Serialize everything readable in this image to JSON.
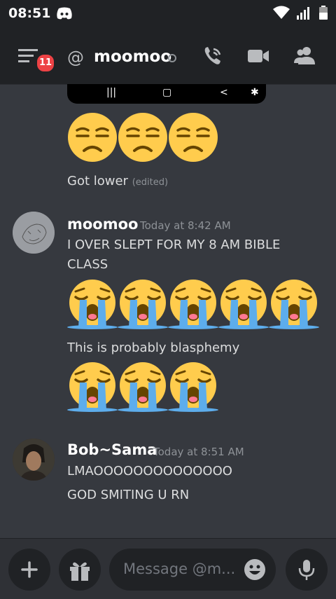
{
  "status_bar": {
    "time": "08:51"
  },
  "header": {
    "unread_count": "11",
    "at_symbol": "@",
    "channel_name": "moomoo"
  },
  "messages": {
    "continuation": {
      "text": "Got lower",
      "edited": "(edited)"
    },
    "group1": {
      "author": "moomoo",
      "timestamp": "Today at 8:42 AM",
      "line1": "I OVER SLEPT FOR MY 8 AM BIBLE",
      "line2": "CLASS",
      "line3": "This is probably blasphemy"
    },
    "group2": {
      "author": "Bob~Sama",
      "timestamp": "Today at 8:51 AM",
      "line1": "LMAOOOOOOOOOOOOOO",
      "line2": "GOD SMITING U RN"
    }
  },
  "composer": {
    "placeholder": "Message @m..."
  },
  "colors": {
    "bg": "#36393f",
    "header_bg": "#202225",
    "badge": "#ed4245",
    "emoji_yellow": "#ffcc4d",
    "tear_blue": "#5dadec"
  },
  "icons": [
    "discord-icon",
    "wifi-icon",
    "signal-icon",
    "battery-icon",
    "menu-icon",
    "phone-call-icon",
    "video-icon",
    "members-icon",
    "plus-icon",
    "gift-icon",
    "emoji-picker-icon",
    "microphone-icon",
    "unamused-face-icon",
    "loudly-crying-face-icon"
  ]
}
